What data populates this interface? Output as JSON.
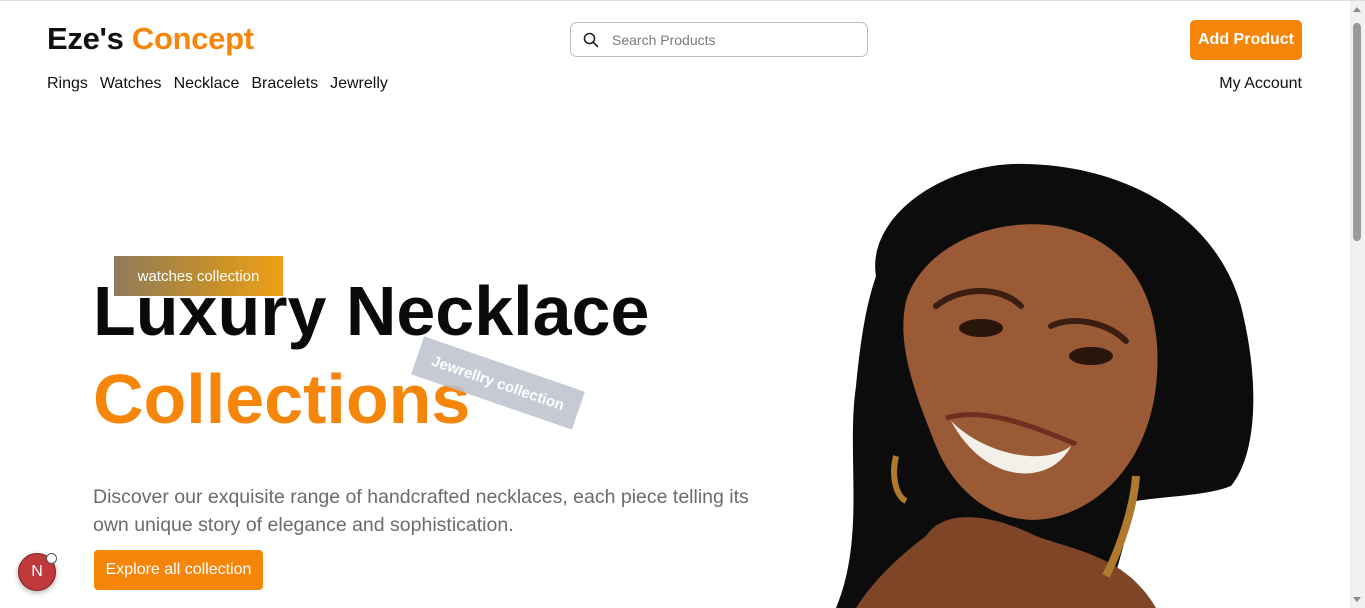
{
  "header": {
    "logo_main": "Eze's",
    "logo_accent": "Concept",
    "search_placeholder": "Search Products",
    "search_value": "",
    "add_product_label": "Add Product",
    "account_label": "My Account"
  },
  "nav": {
    "items": [
      {
        "label": "Rings"
      },
      {
        "label": "Watches"
      },
      {
        "label": "Necklace"
      },
      {
        "label": "Bracelets"
      },
      {
        "label": "Jewrelly"
      }
    ]
  },
  "hero": {
    "title_line1": "Luxury Necklace",
    "title_line2": "Collections",
    "tag_watches": "watches collection",
    "tag_jewelry": "Jewrellry collection",
    "description": "Discover our exquisite range of handcrafted necklaces, each piece telling its own unique story of elegance and sophistication.",
    "cta_label": "Explore all collection"
  },
  "dev_badge": {
    "letter": "N"
  },
  "colors": {
    "accent": "#f5860a",
    "text": "#111111",
    "muted": "#6b6b6b"
  },
  "icons": [
    "search-icon",
    "hero-portrait-image"
  ]
}
